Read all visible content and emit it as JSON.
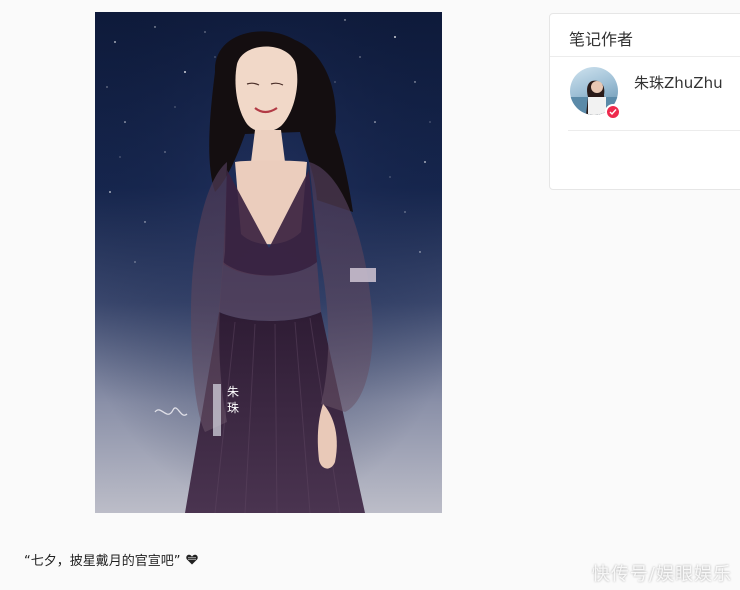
{
  "note": {
    "image_caption_name": "朱珠",
    "text": "“七夕，披星戴月的官宣吧”"
  },
  "author_card": {
    "title": "笔记作者",
    "author_name": "朱珠ZhuZhu"
  },
  "icons": {
    "verified": "verified-check-icon",
    "heart": "black-heart-icon"
  },
  "colors": {
    "verified_badge": "#ee2a4d",
    "sky_top": "#0e1a3a",
    "dress": "#3b2340"
  },
  "watermark": "快传号/娱眼娱乐"
}
